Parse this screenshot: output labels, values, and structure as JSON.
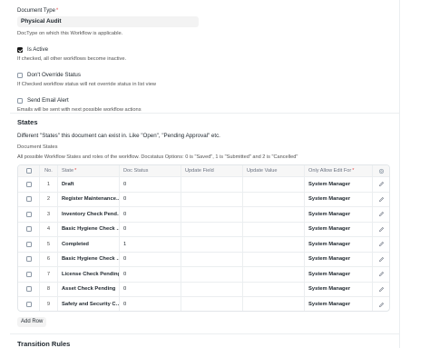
{
  "document_type": {
    "label": "Document Type",
    "required_mark": "*",
    "value": "Physical Audit",
    "description": "DocType on which this Workflow is applicable."
  },
  "is_active": {
    "label": "Is Active",
    "checked": true,
    "description": "If checked, all other workflows become inactive."
  },
  "dont_override": {
    "label": "Don't Override Status",
    "checked": false,
    "description": "If Checked workflow status will not override status in list view"
  },
  "send_email": {
    "label": "Send Email Alert",
    "checked": false,
    "description": "Emails will be sent with next possible workflow actions"
  },
  "states": {
    "heading": "States",
    "description": "Different \"States\" this document can exist in. Like \"Open\", \"Pending Approval\" etc.",
    "table_label": "Document States",
    "table_description": "All possible Workflow States and roles of the workflow. Docstatus Options: 0 is \"Saved\", 1 is \"Submitted\" and 2 is \"Cancelled\"",
    "columns": {
      "no": "No.",
      "state": "State",
      "state_req": "*",
      "doc_status": "Doc Status",
      "update_field": "Update Field",
      "update_value": "Update Value",
      "allow_edit": "Only Allow Edit For",
      "allow_edit_req": "*"
    },
    "rows": [
      {
        "no": "1",
        "state": "Draft",
        "doc_status": "0",
        "role": "System Manager"
      },
      {
        "no": "2",
        "state": "Register Maintenance…",
        "doc_status": "0",
        "role": "System Manager"
      },
      {
        "no": "3",
        "state": "Inventory Check Pend…",
        "doc_status": "0",
        "role": "System Manager"
      },
      {
        "no": "4",
        "state": "Basic Hygiene Check …",
        "doc_status": "0",
        "role": "System Manager"
      },
      {
        "no": "5",
        "state": "Completed",
        "doc_status": "1",
        "role": "System Manager"
      },
      {
        "no": "6",
        "state": "Basic Hygiene Check …",
        "doc_status": "0",
        "role": "System Manager"
      },
      {
        "no": "7",
        "state": "License Check Pending",
        "doc_status": "0",
        "role": "System Manager"
      },
      {
        "no": "8",
        "state": "Asset Check Pending",
        "doc_status": "0",
        "role": "System Manager"
      },
      {
        "no": "9",
        "state": "Safety and Security C…",
        "doc_status": "0",
        "role": "System Manager"
      }
    ],
    "add_row_label": "Add Row"
  },
  "transition_rules": {
    "heading": "Transition Rules"
  },
  "icons": {
    "edit": "edit-icon",
    "settings": "gear-icon"
  }
}
